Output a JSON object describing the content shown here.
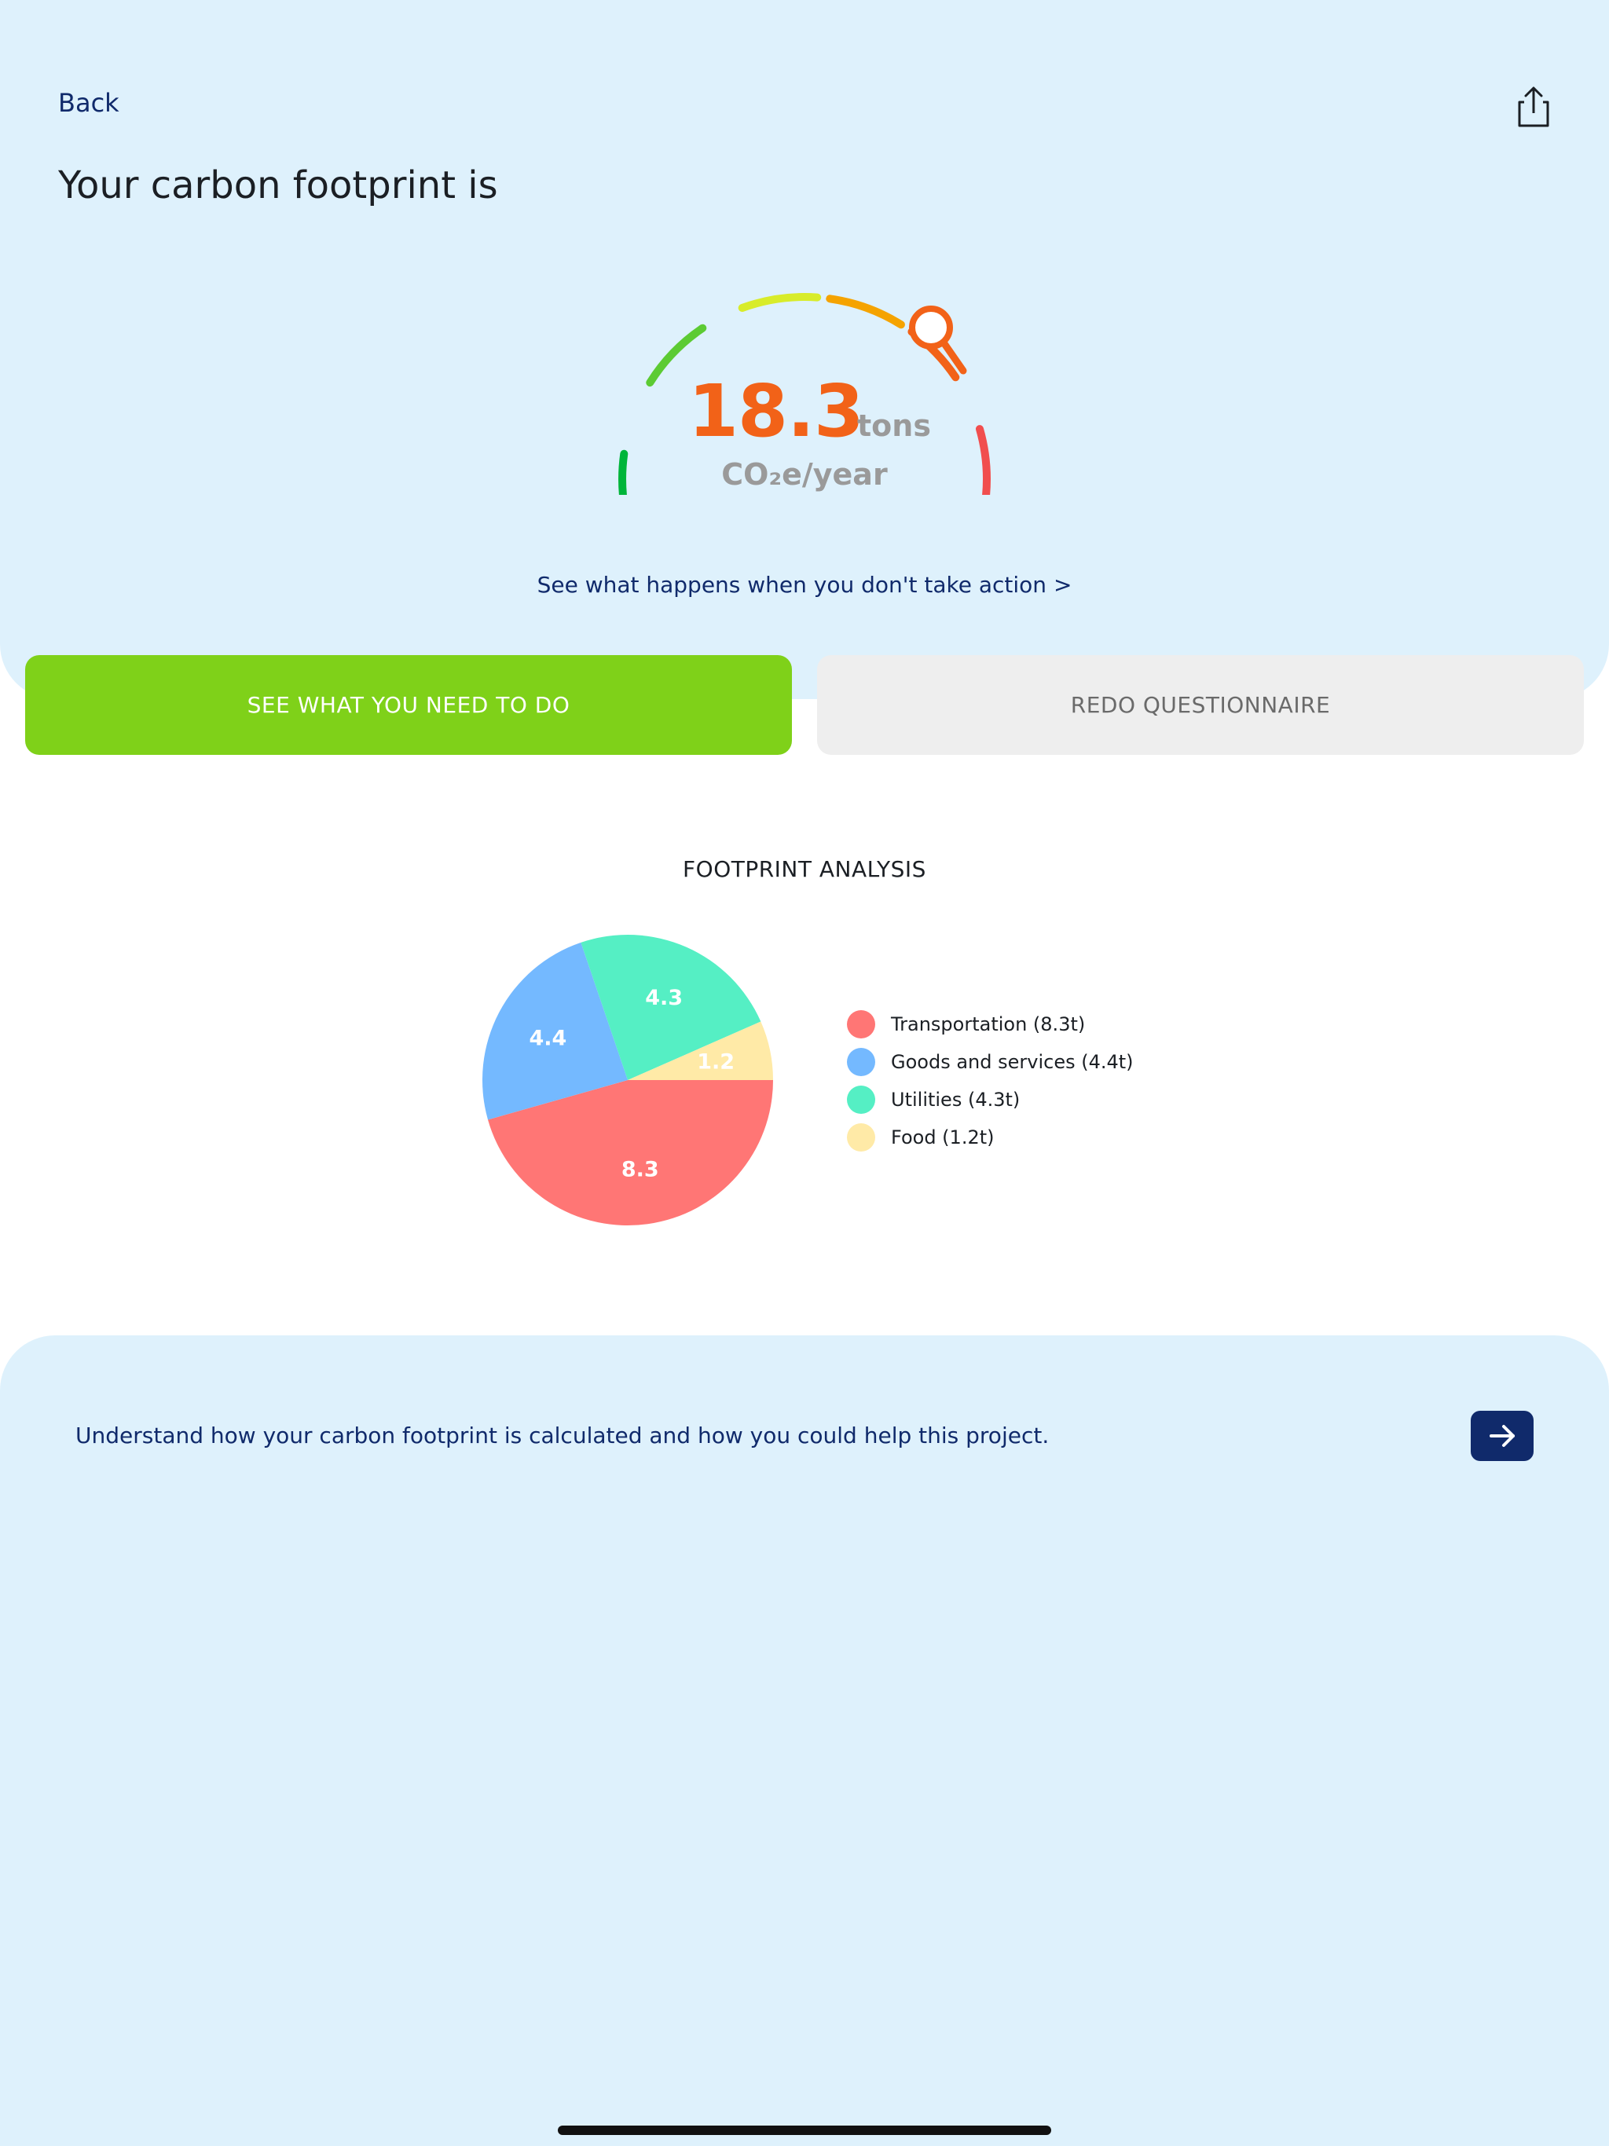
{
  "header": {
    "back_label": "Back",
    "share_icon": "share-icon",
    "title": "Your carbon footprint is"
  },
  "score": {
    "value": "18.3",
    "unit": "tons",
    "subunit": "CO₂e/year",
    "gauge_colors": [
      "#00b53a",
      "#5ccb33",
      "#d8ec2a",
      "#f5a300",
      "#f26218",
      "#f14e4e"
    ],
    "gauge_indicator_icon": "magnifier-icon",
    "gauge_indicator_color": "#f26218"
  },
  "links": {
    "no_action": "See what happens when you don't take action >"
  },
  "buttons": {
    "primary": "SEE WHAT YOU NEED TO DO",
    "secondary": "REDO QUESTIONNAIRE"
  },
  "analysis": {
    "title": "FOOTPRINT ANALYSIS",
    "legend": [
      {
        "label": "Transportation (8.3t)",
        "color": "#ff7675"
      },
      {
        "label": "Goods and services (4.4t)",
        "color": "#74b9ff"
      },
      {
        "label": "Utilities (4.3t)",
        "color": "#55efc4"
      },
      {
        "label": "Food (1.2t)",
        "color": "#ffeaa7"
      }
    ]
  },
  "chart_data": {
    "type": "pie",
    "title": "FOOTPRINT ANALYSIS",
    "categories": [
      "Transportation",
      "Goods and services",
      "Utilities",
      "Food"
    ],
    "values": [
      8.3,
      4.4,
      4.3,
      1.2
    ],
    "data_labels": [
      "8.3",
      "4.4",
      "4.3",
      "1.2"
    ],
    "colors": [
      "#ff7675",
      "#74b9ff",
      "#55efc4",
      "#ffeaa7"
    ],
    "legend_position": "right"
  },
  "info": {
    "text": "Understand how your carbon footprint is calculated and how you could help this project.",
    "arrow_icon": "arrow-right-icon"
  }
}
